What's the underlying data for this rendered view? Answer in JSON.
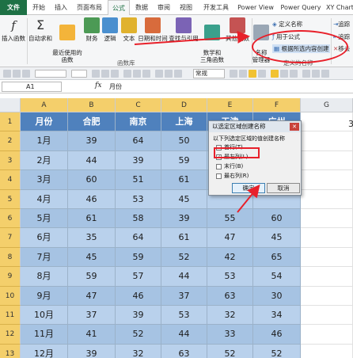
{
  "tabs": [
    "文件",
    "开始",
    "插入",
    "页面布局",
    "公式",
    "数据",
    "审阅",
    "视图",
    "开发工具",
    "Power View",
    "Power Query",
    "XY Chart"
  ],
  "ribbon": {
    "buttons": [
      {
        "label": "插入函数",
        "icon": "fx-icon"
      },
      {
        "label": "自动求和",
        "icon": "sigma-icon"
      },
      {
        "label": "最近使用的\n函数",
        "icon": "star-book-icon"
      },
      {
        "label": "财务",
        "icon": "finance-book-icon"
      },
      {
        "label": "逻辑",
        "icon": "logic-book-icon"
      },
      {
        "label": "文本",
        "icon": "text-book-icon"
      },
      {
        "label": "日期和时间",
        "icon": "clock-book-icon"
      },
      {
        "label": "查找与引用",
        "icon": "lookup-book-icon"
      },
      {
        "label": "数学和\n三角函数",
        "icon": "theta-book-icon"
      },
      {
        "label": "其他函数",
        "icon": "more-book-icon"
      },
      {
        "label": "名称\n管理器",
        "icon": "name-manager-icon"
      }
    ],
    "group_label": "函数库",
    "names_group_label": "定义的名称",
    "define_name": "定义名称",
    "use_in_formula": "用于公式",
    "create_from_selection": "根据所选内容创建",
    "trace_precedents": "追踪",
    "trace_dependents": "追踪",
    "remove_arrows": "移去"
  },
  "formula_bar": {
    "name_box": "A1",
    "fx": "fx",
    "content": "月份",
    "font_select": "常规"
  },
  "columns": [
    "A",
    "B",
    "C",
    "D",
    "E",
    "F",
    "G"
  ],
  "rows": [
    "1",
    "2",
    "3",
    "4",
    "5",
    "6",
    "7",
    "8",
    "9",
    "10",
    "11",
    "12",
    "13"
  ],
  "table": {
    "headers": [
      "月份",
      "合肥",
      "南京",
      "上海",
      "天津",
      "广州"
    ],
    "rows": [
      [
        "1月",
        "39",
        "64",
        "50",
        "",
        ""
      ],
      [
        "2月",
        "44",
        "39",
        "59",
        "",
        ""
      ],
      [
        "3月",
        "60",
        "51",
        "61",
        "",
        ""
      ],
      [
        "4月",
        "46",
        "53",
        "45",
        "",
        ""
      ],
      [
        "5月",
        "61",
        "58",
        "39",
        "55",
        "60"
      ],
      [
        "6月",
        "35",
        "64",
        "61",
        "47",
        "45"
      ],
      [
        "7月",
        "45",
        "59",
        "52",
        "42",
        "65"
      ],
      [
        "8月",
        "59",
        "57",
        "44",
        "53",
        "54"
      ],
      [
        "9月",
        "47",
        "46",
        "37",
        "63",
        "30"
      ],
      [
        "10月",
        "37",
        "39",
        "53",
        "32",
        "34"
      ],
      [
        "11月",
        "41",
        "52",
        "44",
        "33",
        "46"
      ],
      [
        "12月",
        "39",
        "32",
        "63",
        "52",
        "52"
      ]
    ]
  },
  "stray_cell": "3",
  "dialog": {
    "title": "以选定区域创建名称",
    "close": "✕",
    "instruction": "以下列选定区域的值创建名称",
    "options": [
      {
        "label": "首行(T)",
        "checked": false
      },
      {
        "label": "最左列(L)",
        "checked": true
      },
      {
        "label": "末行(B)",
        "checked": false
      },
      {
        "label": "最右列(R)",
        "checked": false
      }
    ],
    "ok": "确定",
    "cancel": "取消"
  }
}
